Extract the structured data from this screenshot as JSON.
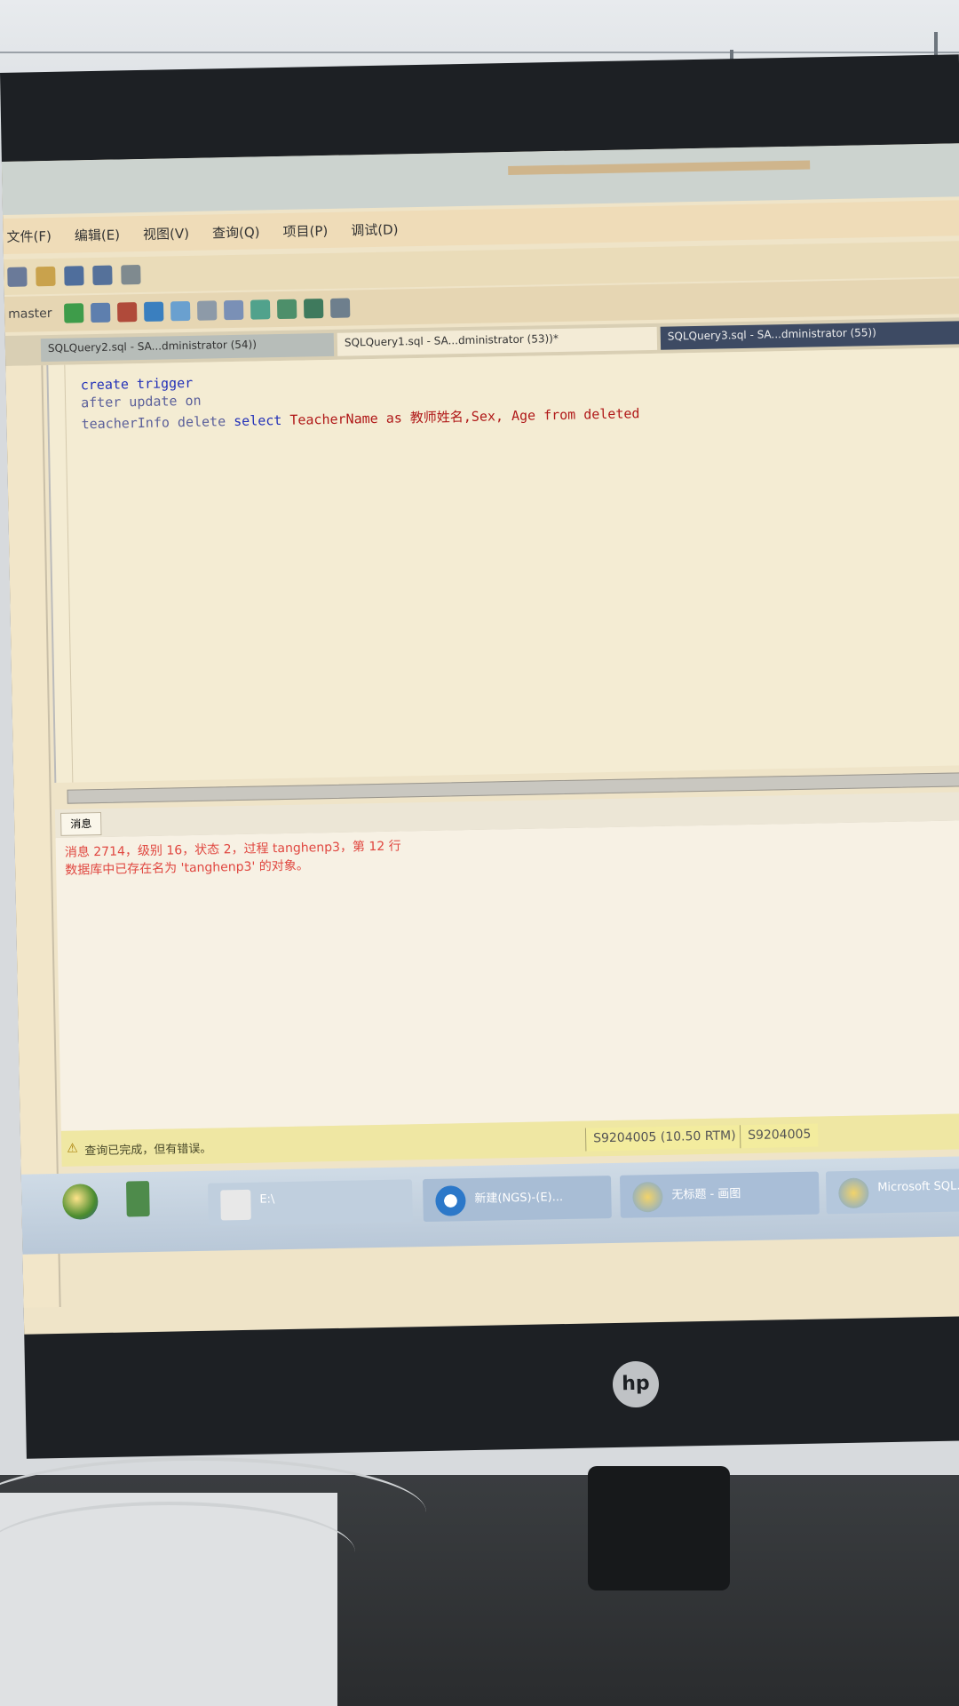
{
  "menu": {
    "items": [
      "文件(F)",
      "编辑(E)",
      "视图(V)",
      "查询(Q)",
      "项目(P)",
      "调试(D)"
    ]
  },
  "toolbar2": {
    "database_selector": "master"
  },
  "tabs": [
    "SQLQuery2.sql - SA...dministrator (54))",
    "SQLQuery1.sql - SA...dministrator (53))*",
    "SQLQuery3.sql - SA...dministrator (55))"
  ],
  "editor": {
    "lines": [
      "create trigger",
      "after update on",
      "teacherInfo delete",
      "select",
      "TeacherName as 教师姓名,Sex, Age from deleted"
    ]
  },
  "results": {
    "tab_label": "消息",
    "messages": [
      "消息 2714，级别 16，状态 2，过程 tanghenp3，第 12 行",
      "数据库中已存在名为 'tanghenp3' 的对象。"
    ]
  },
  "status": {
    "message": "查询已完成，但有错误。",
    "server": "S9204005 (10.50 RTM)",
    "server2": "S9204005"
  },
  "taskbar": {
    "items": [
      "E:\\",
      "新建(NGS)-(E)...",
      "无标题 - 画图",
      "Microsoft SQL..."
    ]
  },
  "monitor": {
    "brand": "hp"
  }
}
